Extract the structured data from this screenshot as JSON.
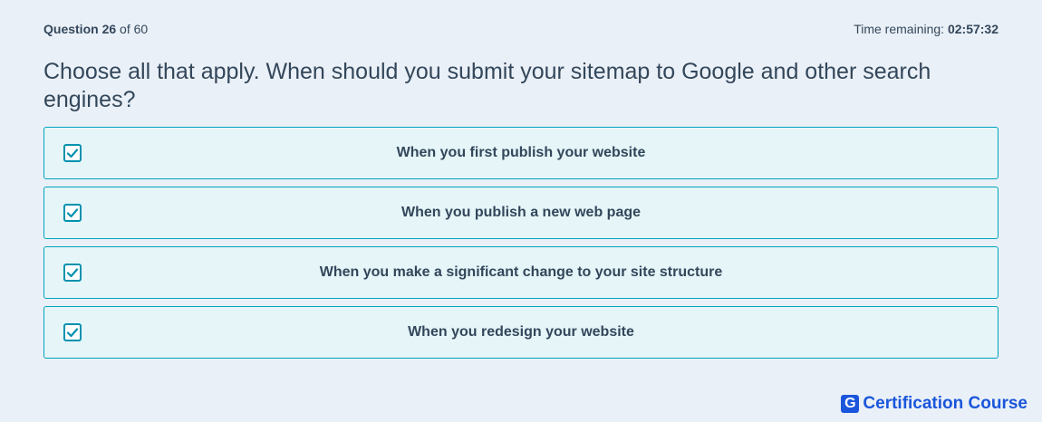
{
  "header": {
    "question_label": "Question",
    "question_number": "26",
    "of_text": "of 60",
    "time_label": "Time remaining:",
    "time_value": "02:57:32"
  },
  "question": {
    "text": "Choose all that apply. When should you submit your sitemap to Google and other search engines?"
  },
  "options": [
    {
      "label": "When you first publish your website",
      "checked": true
    },
    {
      "label": "When you publish a new web page",
      "checked": true
    },
    {
      "label": "When you make a significant change to your site structure",
      "checked": true
    },
    {
      "label": "When you redesign your website",
      "checked": true
    }
  ],
  "brand": {
    "mark": "G",
    "name": "Certification Course",
    "color": "#1a56db"
  },
  "colors": {
    "option_border": "#00a4bd",
    "option_bg": "#e5f5f8",
    "checkbox_border": "#0091ae",
    "text": "#33475b"
  }
}
